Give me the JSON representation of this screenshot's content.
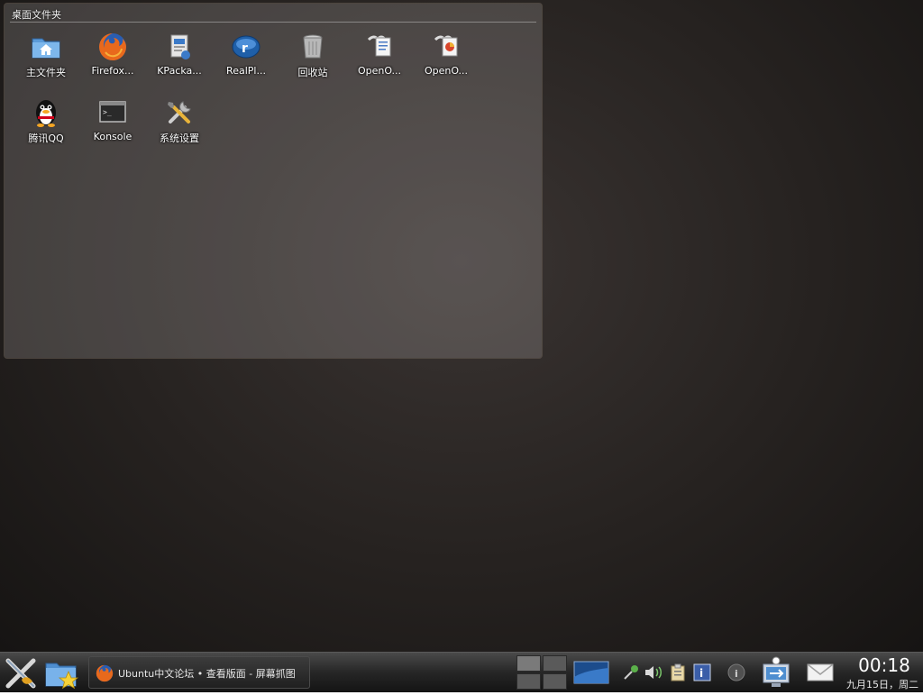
{
  "desktop": {
    "folder_view": {
      "title": "桌面文件夹",
      "items": [
        {
          "label": "主文件夹",
          "icon": "home-folder-icon"
        },
        {
          "label": "Firefox...",
          "icon": "firefox-icon"
        },
        {
          "label": "KPacka...",
          "icon": "kpackage-icon"
        },
        {
          "label": "RealPl...",
          "icon": "realplayer-icon"
        },
        {
          "label": "回收站",
          "icon": "trash-icon"
        },
        {
          "label": "OpenO...",
          "icon": "openoffice-writer-icon"
        },
        {
          "label": "OpenO...",
          "icon": "openoffice-impress-icon"
        },
        {
          "label": "腾讯QQ",
          "icon": "qq-penguin-icon"
        },
        {
          "label": "Konsole",
          "icon": "terminal-icon"
        },
        {
          "label": "系统设置",
          "icon": "system-settings-icon"
        }
      ]
    }
  },
  "taskbar": {
    "launcher_icon": "kde-kickoff-icon",
    "file_manager_icon": "folder-star-icon",
    "task": {
      "icon": "firefox-icon",
      "label": "Ubuntu中文论坛 • 查看版面 - 屏幕抓图"
    },
    "tray_icons": [
      "network-icon",
      "volume-icon",
      "clipboard-icon",
      "info-icon",
      "notification-icon",
      "network-manager-icon",
      "mail-icon"
    ],
    "clock": {
      "time": "00:18",
      "date": "九月15日，周二"
    }
  },
  "colors": {
    "taskbar_bg": "#262626",
    "desktop_text": "#ffffff",
    "panel_border": "#504640"
  }
}
